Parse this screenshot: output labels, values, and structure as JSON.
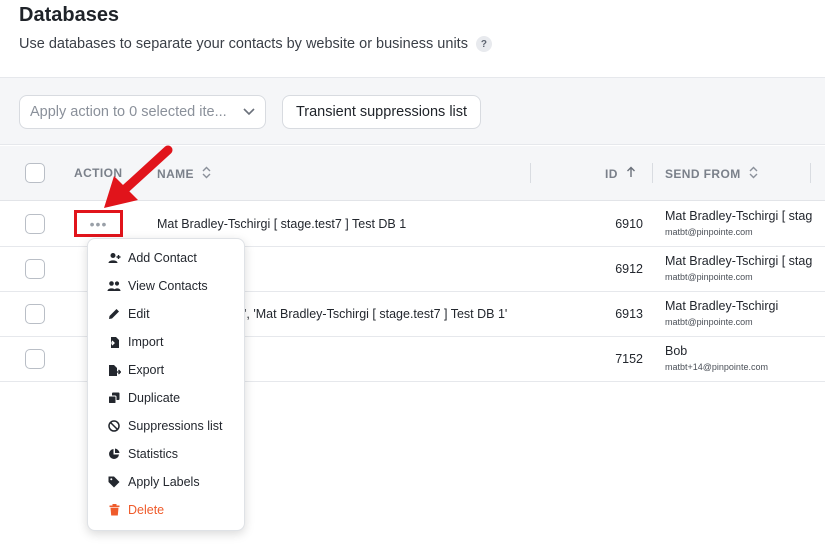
{
  "page": {
    "title": "Databases",
    "subtitle": "Use databases to separate your contacts by website or business units",
    "help_symbol": "?"
  },
  "toolbar": {
    "bulk_action_label": "Apply action to 0 selected ite...",
    "transient_label": "Transient suppressions list"
  },
  "table": {
    "headers": {
      "action": "ACTION",
      "name": "NAME",
      "id": "ID",
      "send_from": "SEND FROM"
    },
    "rows": [
      {
        "name": "Mat Bradley-Tschirgi [ stage.test7 ] Test DB 1",
        "id": "6910",
        "send_from_name": "Mat Bradley-Tschirgi [ stag",
        "send_from_email": "matbt@pinpointe.com"
      },
      {
        "name": "",
        "id": "6912",
        "send_from_name": "Mat Bradley-Tschirgi [ stag",
        "send_from_email": "matbt@pinpointe.com"
      },
      {
        "name": "', 'Mat Bradley-Tschirgi [ stage.test7 ] Test DB 1'",
        "id": "6913",
        "send_from_name": "Mat Bradley-Tschirgi",
        "send_from_email": "matbt@pinpointe.com"
      },
      {
        "name": "",
        "id": "7152",
        "send_from_name": "Bob",
        "send_from_email": "matbt+14@pinpointe.com"
      }
    ]
  },
  "action_trigger": "•••",
  "menu": {
    "items": [
      {
        "label": "Add Contact",
        "icon": "add-user-icon"
      },
      {
        "label": "View Contacts",
        "icon": "users-icon"
      },
      {
        "label": "Edit",
        "icon": "pencil-icon"
      },
      {
        "label": "Import",
        "icon": "import-icon"
      },
      {
        "label": "Export",
        "icon": "export-icon"
      },
      {
        "label": "Duplicate",
        "icon": "duplicate-icon"
      },
      {
        "label": "Suppressions list",
        "icon": "ban-icon"
      },
      {
        "label": "Statistics",
        "icon": "pie-chart-icon"
      },
      {
        "label": "Apply Labels",
        "icon": "tag-icon"
      },
      {
        "label": "Delete",
        "icon": "trash-icon"
      }
    ]
  },
  "colors": {
    "accent_red": "#e1141b",
    "danger": "#ef5b2b",
    "header_bg": "#f5f6f8"
  }
}
